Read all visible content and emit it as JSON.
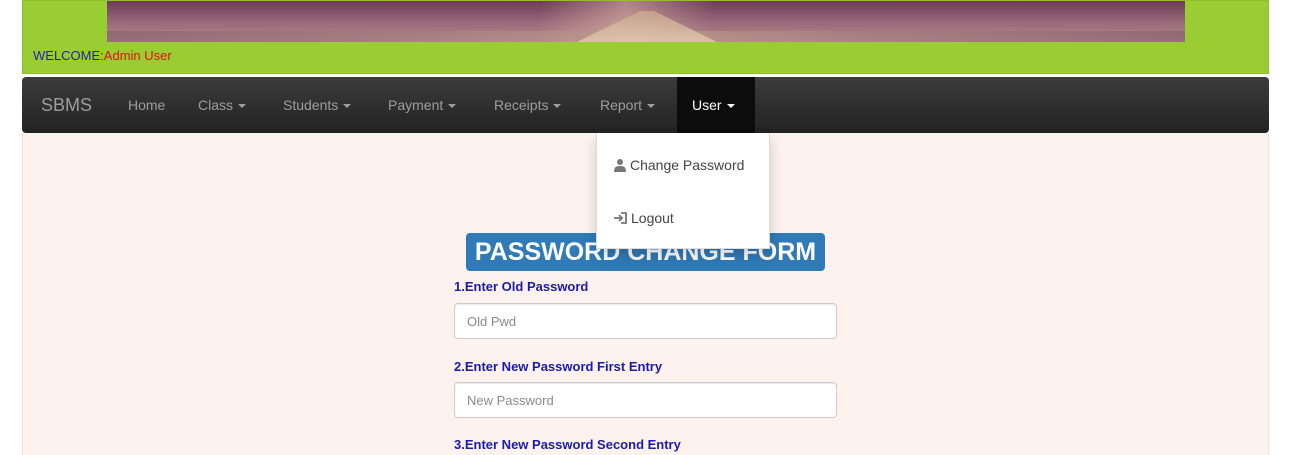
{
  "header": {
    "welcome_label": "WELCOME:",
    "welcome_user": "Admin User"
  },
  "navbar": {
    "brand": "SBMS",
    "items": [
      {
        "label": "Home",
        "caret": false
      },
      {
        "label": "Class",
        "caret": true
      },
      {
        "label": "Students",
        "caret": true
      },
      {
        "label": "Payment",
        "caret": true
      },
      {
        "label": "Receipts",
        "caret": true
      },
      {
        "label": "Report",
        "caret": true
      },
      {
        "label": "User",
        "caret": true,
        "active": true
      }
    ]
  },
  "user_menu": {
    "items": [
      {
        "label": "Change Password",
        "icon": "user-icon"
      },
      {
        "label": "Logout",
        "icon": "logout-icon"
      }
    ]
  },
  "form": {
    "title": "PASSWORD CHANGE FORM",
    "old_label": "1.Enter Old Password",
    "old_placeholder": "Old Pwd",
    "new_label": "2.Enter New Password First Entry",
    "new_placeholder": "New Password",
    "confirm_label": "3.Enter New Password Second Entry"
  },
  "colors": {
    "header_bg": "#9acd32",
    "welcome_label": "#1f1fb5",
    "welcome_user": "#e01212",
    "navbar_bg": "#222222",
    "content_bg": "#fdf2ed",
    "form_title_bg": "#2f7ab7",
    "form_label": "#1a1ab0"
  }
}
